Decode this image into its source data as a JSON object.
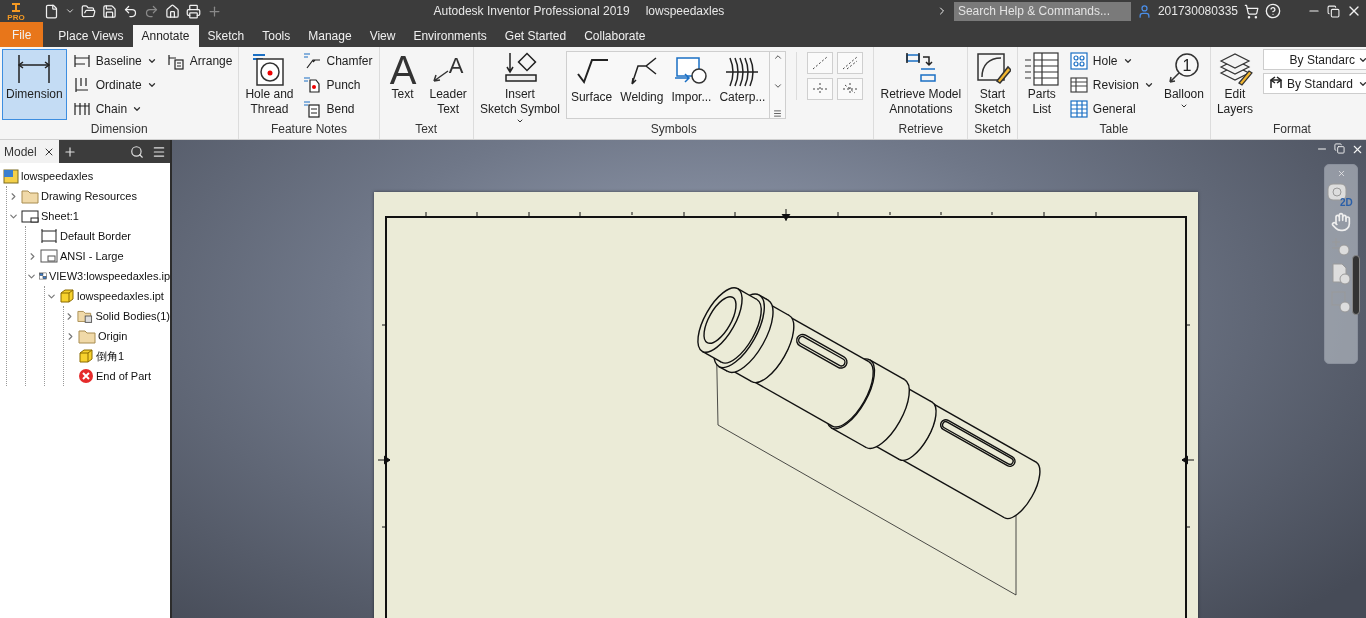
{
  "title_bar": {
    "logo_badge": "PRO",
    "title": "Autodesk Inventor Professional 2019",
    "document": "lowspeedaxles",
    "search": {
      "placeholder": "Search Help & Commands..."
    },
    "user": "201730080335"
  },
  "ribbon_tabs": [
    {
      "label": "File",
      "kind": "file",
      "selected": false
    },
    {
      "label": "Place Views",
      "kind": "tab",
      "selected": false
    },
    {
      "label": "Annotate",
      "kind": "tab",
      "selected": true
    },
    {
      "label": "Sketch",
      "kind": "tab",
      "selected": false
    },
    {
      "label": "Tools",
      "kind": "tab",
      "selected": false
    },
    {
      "label": "Manage",
      "kind": "tab",
      "selected": false
    },
    {
      "label": "View",
      "kind": "tab",
      "selected": false
    },
    {
      "label": "Environments",
      "kind": "tab",
      "selected": false
    },
    {
      "label": "Get Started",
      "kind": "tab",
      "selected": false
    },
    {
      "label": "Collaborate",
      "kind": "tab",
      "selected": false
    }
  ],
  "ribbon": [
    {
      "title": "Dimension",
      "columns": [
        {
          "kind": "large",
          "items": [
            {
              "lines": [
                "Dimension"
              ],
              "active": true
            }
          ]
        },
        {
          "kind": "small",
          "items": [
            {
              "label": "Baseline",
              "dropdown": true,
              "active": false
            },
            {
              "label": "Ordinate",
              "dropdown": true,
              "active": false
            },
            {
              "label": "Chain",
              "dropdown": true,
              "active": false
            }
          ]
        },
        {
          "kind": "small",
          "items": [
            {
              "label": "Arrange",
              "dropdown": false,
              "active": false
            }
          ]
        }
      ]
    },
    {
      "title": "Feature Notes",
      "columns": [
        {
          "kind": "large",
          "items": [
            {
              "lines": [
                "Hole and",
                "Thread"
              ],
              "active": false
            }
          ]
        },
        {
          "kind": "small",
          "items": [
            {
              "label": "Chamfer",
              "dropdown": false,
              "active": false
            },
            {
              "label": "Punch",
              "dropdown": false,
              "active": false
            },
            {
              "label": "Bend",
              "dropdown": false,
              "active": false
            }
          ]
        }
      ]
    },
    {
      "title": "Text",
      "columns": [
        {
          "kind": "large",
          "items": [
            {
              "lines": [
                "Text"
              ],
              "glyph": "A",
              "active": false
            }
          ]
        },
        {
          "kind": "large",
          "items": [
            {
              "lines": [
                "Leader",
                "Text"
              ],
              "glyph": "A",
              "active": false
            }
          ]
        }
      ]
    },
    {
      "title": "Symbols",
      "columns": [
        {
          "kind": "large",
          "items": [
            {
              "lines": [
                "Insert",
                "Sketch Symbol"
              ],
              "dropdown": true,
              "active": false
            }
          ]
        },
        {
          "kind": "gallery",
          "items": [
            {
              "lines": [
                "Surface"
              ],
              "active": false
            },
            {
              "lines": [
                "Welding"
              ],
              "active": false
            },
            {
              "lines": [
                "Impor..."
              ],
              "active": false
            },
            {
              "lines": [
                "Caterp..."
              ],
              "active": false
            }
          ]
        },
        {
          "kind": "grid"
        }
      ]
    },
    {
      "title": "Retrieve",
      "columns": [
        {
          "kind": "large",
          "items": [
            {
              "lines": [
                "Retrieve Model",
                "Annotations"
              ],
              "active": false
            }
          ]
        }
      ]
    },
    {
      "title": "Sketch",
      "columns": [
        {
          "kind": "large",
          "items": [
            {
              "lines": [
                "Start",
                "Sketch"
              ],
              "active": false
            }
          ]
        }
      ]
    },
    {
      "title": "Table",
      "columns": [
        {
          "kind": "large",
          "items": [
            {
              "lines": [
                "Parts",
                "List"
              ],
              "active": false
            }
          ]
        },
        {
          "kind": "small",
          "items": [
            {
              "label": "Hole",
              "dropdown": true,
              "active": false
            },
            {
              "label": "Revision",
              "dropdown": true,
              "active": false
            },
            {
              "label": "General",
              "dropdown": false,
              "active": false
            }
          ]
        },
        {
          "kind": "large",
          "items": [
            {
              "lines": [
                "Balloon"
              ],
              "glyph": "1",
              "dropdown": true,
              "active": false
            }
          ]
        }
      ]
    },
    {
      "title": "Format",
      "columns": [
        {
          "kind": "large",
          "items": [
            {
              "lines": [
                "Edit",
                "Layers"
              ],
              "active": false
            }
          ]
        },
        {
          "kind": "selects",
          "items": [
            {
              "value": "By Standarc"
            },
            {
              "value": "By Standard"
            }
          ]
        }
      ]
    }
  ],
  "browser": {
    "tabs": [
      {
        "label": "Model",
        "selected": true
      }
    ],
    "tree": [
      {
        "label": "lowspeedaxles",
        "kind": "drawing",
        "children": [
          {
            "label": "Drawing Resources",
            "kind": "folder",
            "expanded": false
          },
          {
            "label": "Sheet:1",
            "kind": "sheet",
            "expanded": true,
            "children": [
              {
                "label": "Default Border",
                "kind": "border"
              },
              {
                "label": "ANSI - Large",
                "kind": "title-block",
                "expanded": false
              },
              {
                "label": "VIEW3:lowspeedaxles.ip",
                "kind": "view",
                "expanded": true,
                "children": [
                  {
                    "label": "lowspeedaxles.ipt",
                    "kind": "part",
                    "expanded": true,
                    "children": [
                      {
                        "label": "Solid Bodies(1)",
                        "kind": "bodies",
                        "expanded": false
                      },
                      {
                        "label": "Origin",
                        "kind": "folder",
                        "expanded": false
                      },
                      {
                        "label": "倒角1",
                        "kind": "feature"
                      },
                      {
                        "label": "End of Part",
                        "kind": "end"
                      }
                    ]
                  }
                ]
              }
            ]
          }
        ]
      }
    ]
  },
  "navigation_bar": {
    "wheel_label": "2D"
  }
}
